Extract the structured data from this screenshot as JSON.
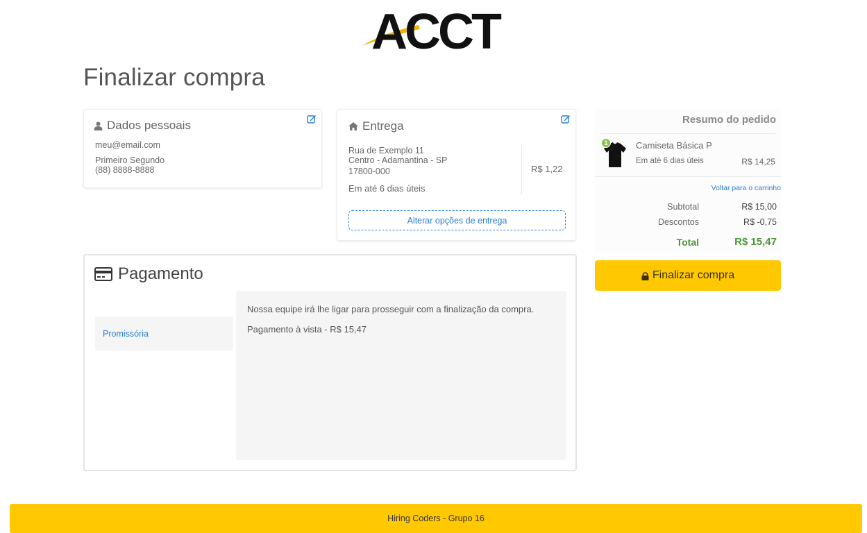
{
  "brand": {
    "name": "ACCT",
    "accent": "#ffc800",
    "link": "#2a7ed3",
    "total_color": "#4a9634"
  },
  "page": {
    "title": "Finalizar compra"
  },
  "personal": {
    "title": "Dados pessoais",
    "icon": "user-icon",
    "email": "meu@email.com",
    "name": "Primeiro Segundo",
    "phone": "(88) 8888-8888"
  },
  "delivery": {
    "title": "Entrega",
    "icon": "home-icon",
    "address_line1": "Rua de Exemplo 11",
    "address_line2": "Centro - Adamantina - SP",
    "postal_code": "17800-000",
    "eta": "Em até 6 dias úteis",
    "price": "R$ 1,22",
    "change_label": "Alterar opções de entrega"
  },
  "summary": {
    "title": "Resumo do pedido",
    "item": {
      "qty": "1",
      "name": "Camiseta Básica P",
      "eta": "Em até 6 dias úteis",
      "price": "R$ 14,25"
    },
    "back_to_cart": "Voltar para o carrinho",
    "subtotal_label": "Subtotal",
    "subtotal_value": "R$ 15,00",
    "discount_label": "Descontos",
    "discount_value": "R$ -0,75",
    "total_label": "Total",
    "total_value": "R$ 15,47",
    "finalize_label": "Finalizar compra"
  },
  "payment": {
    "title": "Pagamento",
    "icon": "credit-card-icon",
    "method": "Promissória",
    "info": "Nossa equipe irá lhe ligar para prosseguir com a finalização da compra.",
    "amount": "Pagamento à vista - R$ 15,47"
  },
  "footer": {
    "text": "Hiring Coders - Grupo 16"
  }
}
